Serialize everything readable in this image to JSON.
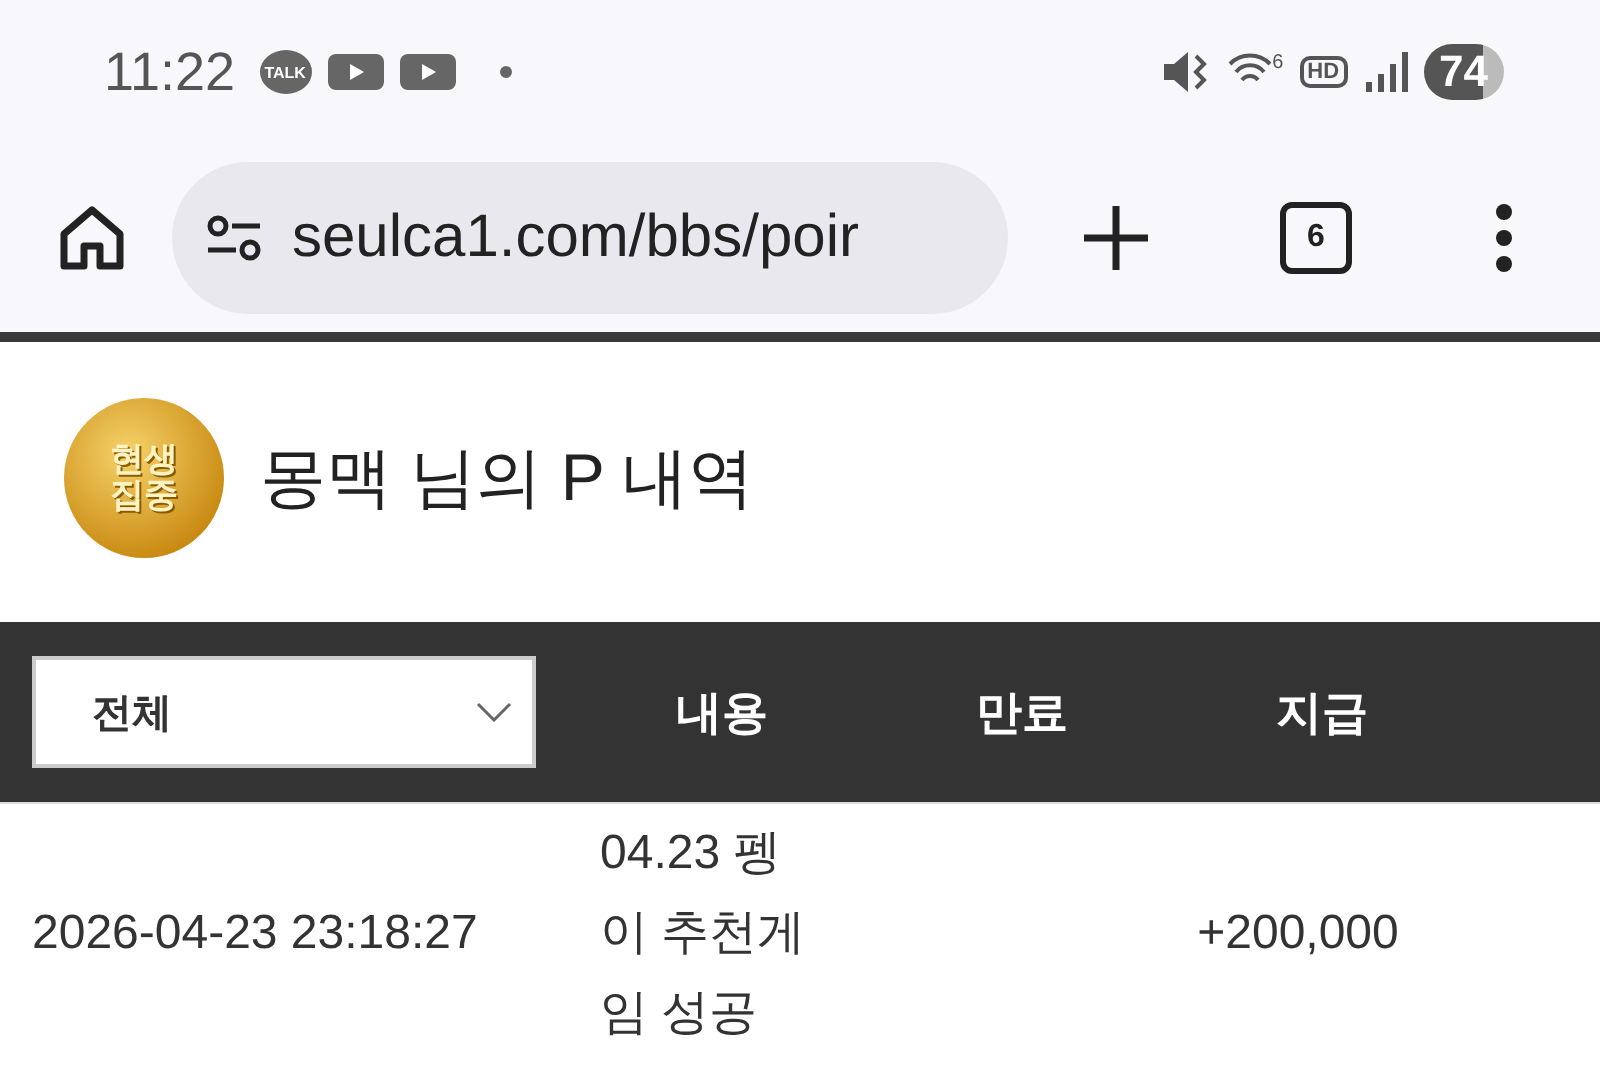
{
  "status_bar": {
    "time": "11:22",
    "talk_label": "TALK",
    "wifi_label": "6",
    "hd_label": "HD",
    "battery": "74"
  },
  "browser": {
    "url": "seulca1.com/bbs/poir",
    "tab_count": "6"
  },
  "header": {
    "logo_lines": [
      "현생",
      "집중"
    ],
    "title": "몽맥 님의 P 내역"
  },
  "table": {
    "filter": {
      "value": "전체"
    },
    "columns": [
      "내용",
      "만료",
      "지급"
    ],
    "rows": [
      {
        "date": "2026-04-23 23:18:27",
        "content": "04.23 펭이 추천게임 성공",
        "expiry": "",
        "amount": "+200,000"
      }
    ]
  }
}
